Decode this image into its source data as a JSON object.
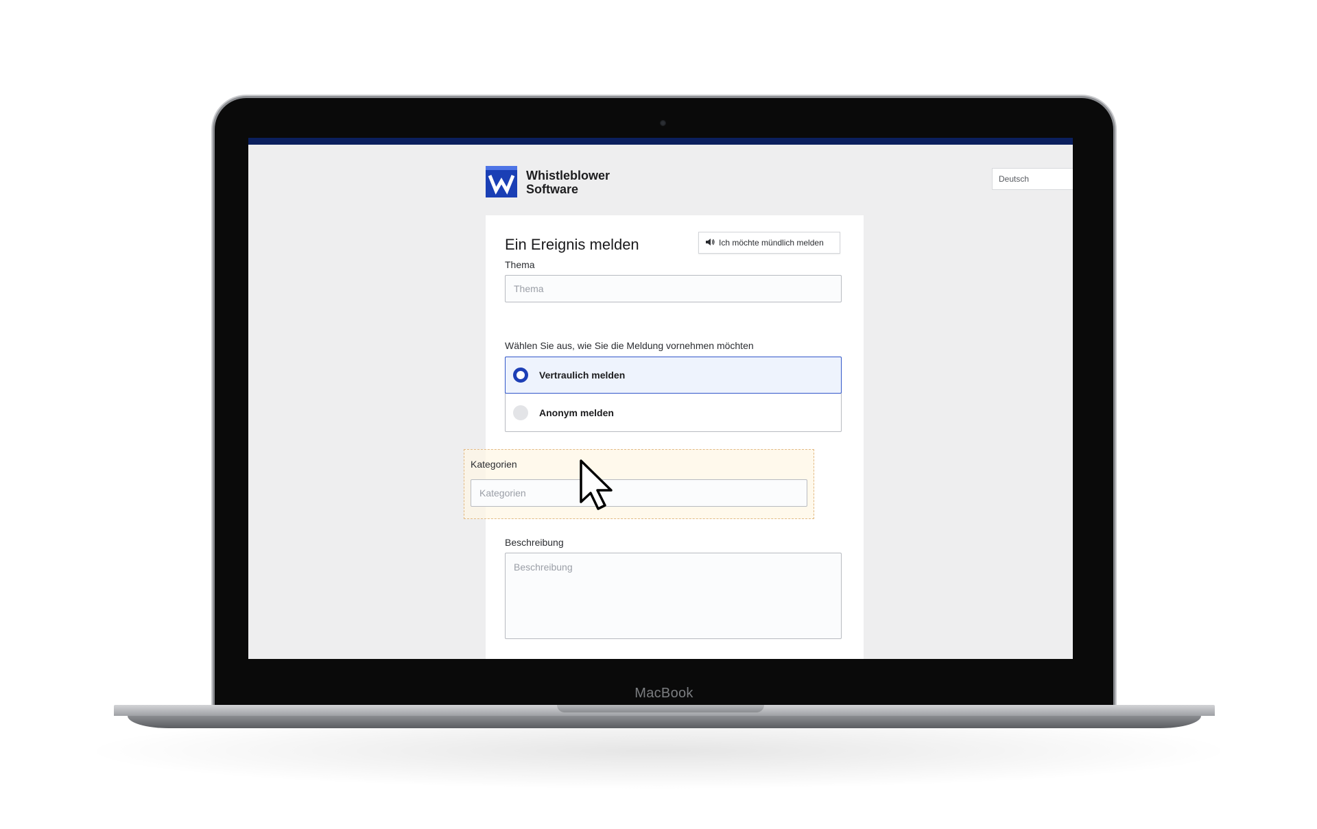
{
  "device": {
    "brand_label": "MacBook"
  },
  "app": {
    "logo": {
      "line1": "Whistleblower",
      "line2": "Software"
    },
    "language_select": {
      "value": "Deutsch"
    }
  },
  "form": {
    "title": "Ein Ereignis melden",
    "oral_report_button": "Ich möchte mündlich melden",
    "topic": {
      "label": "Thema",
      "placeholder": "Thema"
    },
    "report_mode": {
      "label": "Wählen Sie aus, wie Sie die Meldung vornehmen möchten",
      "options": [
        {
          "label": "Vertraulich melden",
          "selected": true
        },
        {
          "label": "Anonym melden",
          "selected": false
        }
      ]
    },
    "categories": {
      "label": "Kategorien",
      "placeholder": "Kategorien"
    },
    "description": {
      "label": "Beschreibung",
      "placeholder": "Beschreibung"
    }
  },
  "colors": {
    "accent": "#1d3fb6",
    "top_bar": "#0b1f5e",
    "drag_border": "#e2b982"
  },
  "icons": [
    "logo-w-icon",
    "chevron-down-icon",
    "speaker-icon",
    "mouse-pointer-icon",
    "camera-icon"
  ]
}
